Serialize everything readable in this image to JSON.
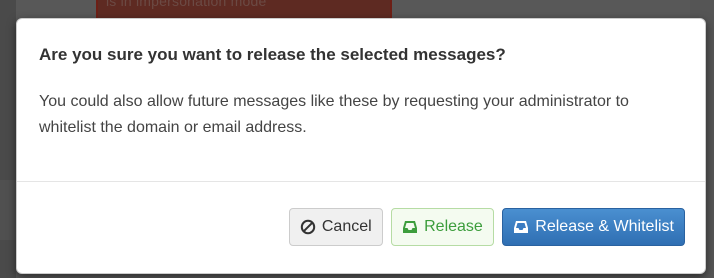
{
  "backdrop": {
    "banner_text": "is in impersonation mode"
  },
  "dialog": {
    "title": "Are you sure you want to release the selected messages?",
    "message": "You could also allow future messages like these by requesting your administrator to whitelist the domain or email address."
  },
  "buttons": {
    "cancel_label": "Cancel",
    "release_label": "Release",
    "release_whitelist_label": "Release & Whitelist"
  },
  "icons": {
    "cancel": "ban-icon",
    "release": "inbox-tray-icon",
    "release_whitelist": "inbox-tray-icon"
  },
  "colors": {
    "primary": "#337ab7",
    "success": "#3c9d3c",
    "default_text": "#333333"
  }
}
